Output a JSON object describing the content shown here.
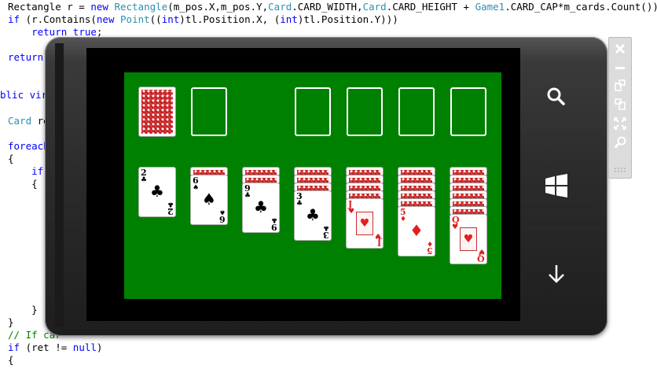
{
  "editor": {
    "lines": {
      "l1": [
        "Rectangle r = ",
        "new",
        " ",
        "Rectangle",
        "(m_pos.X,m_pos.Y,",
        "Card",
        ".CARD_WIDTH,",
        "Card",
        ".CARD_HEIGHT + ",
        "Game1",
        ".CARD_CAP*m_cards.Count());"
      ],
      "l2_a": "if",
      "l2_b": " (r.Contains(",
      "l2_c": "new",
      "l2_d": " ",
      "l2_e": "Point",
      "l2_f": "((",
      "l2_g": "int",
      "l2_h": ")tl.Position.X, (",
      "l2_i": "int",
      "l2_j": ")tl.Position.Y)))",
      "l3_a": "    ",
      "l3_b": "return",
      "l3_c": " ",
      "l3_d": "true",
      "l3_e": ";",
      "l4": "return",
      "l5": "blic virt",
      "l6_a": "Card",
      "l6_b": " re",
      "l7": "foreach",
      "l8": "{",
      "l9": "    if",
      "l10": "    {",
      "l11": "    }",
      "l12": "}",
      "l13": "// If car",
      "l14_a": "if",
      "l14_b": " (ret != ",
      "l14_c": "null",
      "l14_d": ")",
      "l15": "{"
    }
  },
  "emulator": {
    "buttons": {
      "search": "search-icon",
      "start": "windows-logo-icon",
      "back": "back-arrow-icon"
    },
    "toolbar": {
      "items": [
        "close-icon",
        "minimize-icon",
        "rotate-left-icon",
        "rotate-right-icon",
        "fit-to-screen-icon",
        "zoom-icon"
      ]
    }
  },
  "game": {
    "colors": {
      "table": "#008000",
      "red_suit": "#e02020",
      "card_back": "#c42222"
    },
    "stock": {
      "face_down": true
    },
    "foundations": [
      "empty",
      "empty",
      "empty",
      "empty"
    ],
    "waste": "empty",
    "tableau": [
      {
        "hidden": 0,
        "rank": "2",
        "suit": "♣",
        "color": "black"
      },
      {
        "hidden": 1,
        "rank": "6",
        "suit": "♠",
        "color": "black"
      },
      {
        "hidden": 2,
        "rank": "9",
        "suit": "♣",
        "color": "black"
      },
      {
        "hidden": 3,
        "rank": "3",
        "suit": "♣",
        "color": "black"
      },
      {
        "hidden": 4,
        "rank": "J",
        "suit": "♥",
        "color": "red"
      },
      {
        "hidden": 5,
        "rank": "5",
        "suit": "♦",
        "color": "red"
      },
      {
        "hidden": 6,
        "rank": "Q",
        "suit": "♥",
        "color": "red"
      }
    ]
  }
}
